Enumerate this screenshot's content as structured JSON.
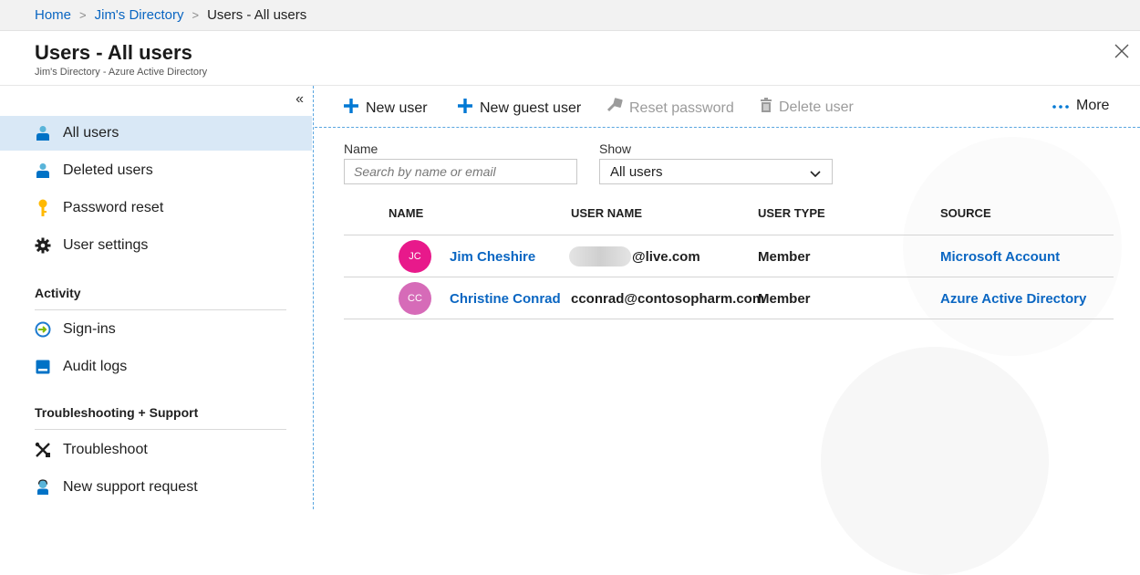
{
  "breadcrumb": {
    "items": [
      {
        "label": "Home"
      },
      {
        "label": "Jim's Directory"
      },
      {
        "label": "Users - All users"
      }
    ],
    "separator": ">"
  },
  "header": {
    "title": "Users - All users",
    "subtitle": "Jim's Directory - Azure Active Directory",
    "close_icon": "close-icon"
  },
  "sidebar": {
    "collapse_glyph": "«",
    "items": [
      {
        "label": "All users",
        "icon": "user-icon",
        "active": true
      },
      {
        "label": "Deleted users",
        "icon": "user-icon"
      },
      {
        "label": "Password reset",
        "icon": "key-icon"
      },
      {
        "label": "User settings",
        "icon": "gear-icon"
      }
    ],
    "sections": [
      {
        "title": "Activity",
        "items": [
          {
            "label": "Sign-ins",
            "icon": "sign-in-icon"
          },
          {
            "label": "Audit logs",
            "icon": "audit-log-icon"
          }
        ]
      },
      {
        "title": "Troubleshooting + Support",
        "items": [
          {
            "label": "Troubleshoot",
            "icon": "tools-icon"
          },
          {
            "label": "New support request",
            "icon": "support-icon"
          }
        ]
      }
    ]
  },
  "toolbar": {
    "new_user": "New user",
    "new_guest_user": "New guest user",
    "reset_password": "Reset password",
    "delete_user": "Delete user",
    "more": "More"
  },
  "filters": {
    "name_label": "Name",
    "search_placeholder": "Search by name or email",
    "show_label": "Show",
    "show_value": "All users"
  },
  "table": {
    "columns": [
      "NAME",
      "USER NAME",
      "USER TYPE",
      "SOURCE"
    ],
    "rows": [
      {
        "initials": "JC",
        "name": "Jim Cheshire",
        "username": "@live.com",
        "username_obscured": true,
        "user_type": "Member",
        "source": "Microsoft Account",
        "avatar_color": "#e8198b"
      },
      {
        "initials": "CC",
        "name": "Christine Conrad",
        "username": "cconrad@contosopharm.com",
        "user_type": "Member",
        "source": "Azure Active Directory",
        "avatar_color": "#d66bb8"
      }
    ]
  },
  "colors": {
    "link": "#0a66c2",
    "accent": "#0078d4",
    "active_bg": "#d9e8f6"
  }
}
